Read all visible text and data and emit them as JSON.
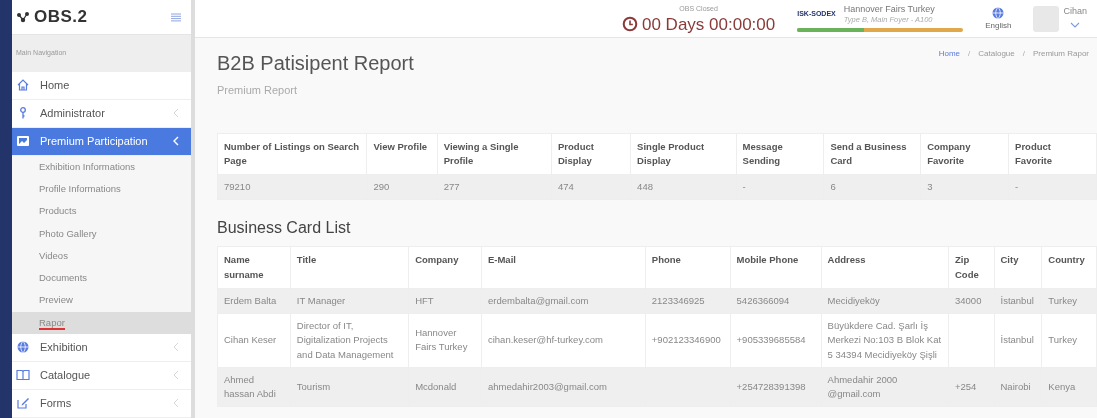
{
  "logo": {
    "text": "OBS.2"
  },
  "header": {
    "status": "OBS Closed",
    "countdown": "00 Days 00:00:00",
    "fair": {
      "logo_text": "ISK-SODEX",
      "name": "Hannover Fairs Turkey",
      "location": "Type B, Main Foyer - A100",
      "level": 0.4
    },
    "language": "English",
    "user": "Cihan"
  },
  "sidebar": {
    "heading": "Main Navigation",
    "items": [
      {
        "label": "Home",
        "selected": false
      },
      {
        "label": "Administrator",
        "selected": false,
        "expanded": false
      },
      {
        "label": "Premium Participation",
        "selected": true,
        "expanded": true,
        "children": [
          {
            "label": "Exhibition Informations",
            "selected": false
          },
          {
            "label": "Profile Informations",
            "selected": false
          },
          {
            "label": "Products",
            "selected": false
          },
          {
            "label": "Photo Gallery",
            "selected": false
          },
          {
            "label": "Videos",
            "selected": false
          },
          {
            "label": "Documents",
            "selected": false
          },
          {
            "label": "Preview",
            "selected": false
          },
          {
            "label": "Rapor",
            "selected": true
          }
        ]
      },
      {
        "label": "Exhibition",
        "selected": false,
        "expanded": false
      },
      {
        "label": "Catalogue",
        "selected": false,
        "expanded": false
      },
      {
        "label": "Forms",
        "selected": false,
        "expanded": false
      }
    ]
  },
  "page": {
    "title": "B2B Patisipent Report",
    "subtitle": "Premium Report",
    "breadcrumb_separator": "/",
    "breadcrumb": [
      "Home",
      "Catalogue",
      "Premium Rapor"
    ]
  },
  "stats_table": {
    "columns": [
      "Number of Listings on Search Page",
      "View Profile",
      "Viewing a Single Profile",
      "Product Display",
      "Single Product Display",
      "Message Sending",
      "Send a Business Card",
      "Company Favorite",
      "Product Favorite"
    ],
    "rows": [
      [
        "79210",
        "290",
        "277",
        "474",
        "448",
        "-",
        "6",
        "3",
        "-"
      ]
    ]
  },
  "business_cards": {
    "title": "Business Card List",
    "columns": [
      "Name surname",
      "Title",
      "Company",
      "E-Mail",
      "Phone",
      "Mobile Phone",
      "Address",
      "Zip Code",
      "City",
      "Country"
    ],
    "rows": [
      [
        "Erdem Balta",
        "IT Manager",
        "HFT",
        "erdembalta@gmail.com",
        "2123346925",
        "5426366094",
        "Mecidiyeköy",
        "34000",
        "İstanbul",
        "Turkey"
      ],
      [
        "Cihan Keser",
        "Director of IT, Digitalization Projects and Data Management",
        "Hannover Fairs Turkey",
        "cihan.keser@hf-turkey.com",
        "+902123346900",
        "+905339685584",
        "Büyükdere Cad. Şarlı İş Merkezi No:103 B Blok Kat 5 34394 Mecidiyeköy Şişli",
        "",
        "İstanbul",
        "Turkey"
      ],
      [
        "Ahmed hassan Abdi",
        "Tourism",
        "Mcdonald",
        "ahmedahir2003@gmail.com",
        "",
        "+254728391398",
        "Ahmedahir 2000 @gmail.com",
        "+254",
        "Nairobi",
        "Kenya"
      ]
    ]
  }
}
